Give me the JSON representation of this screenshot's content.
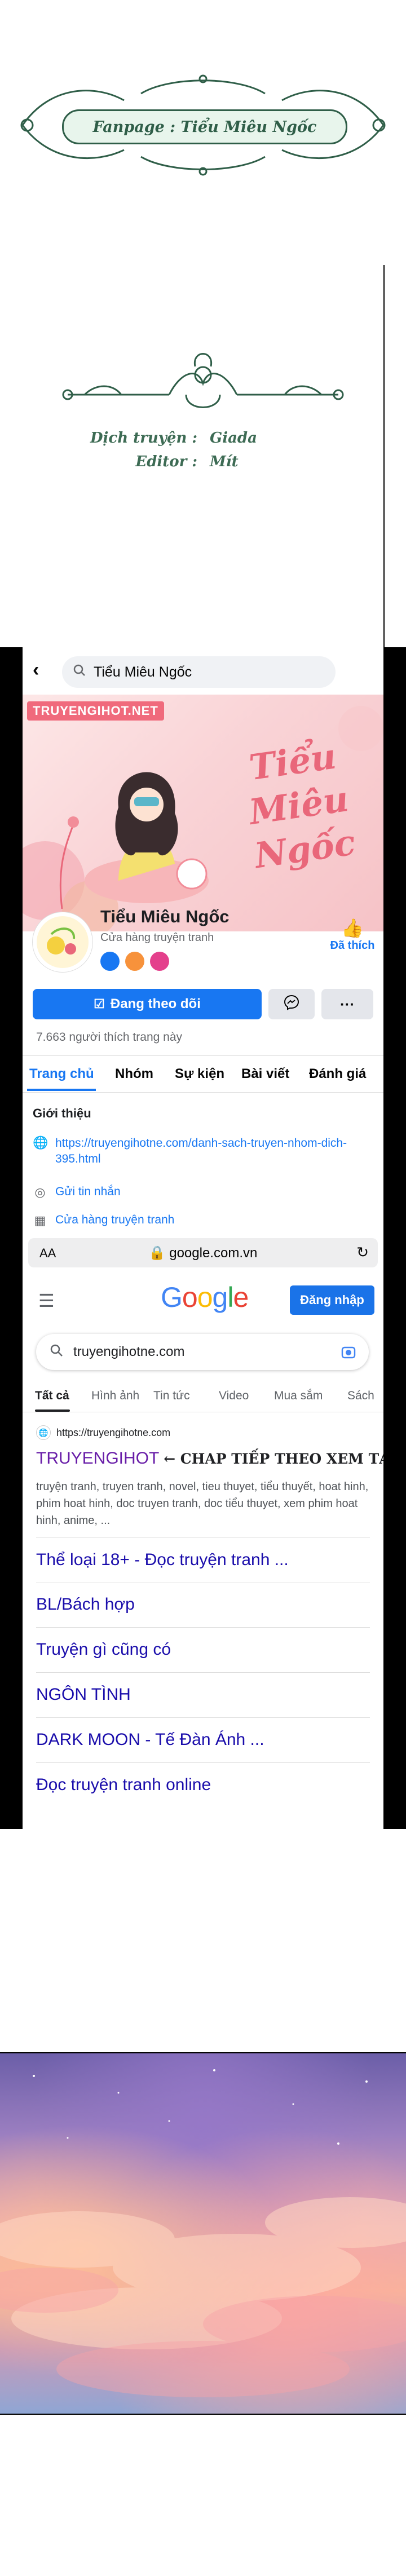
{
  "header": {
    "fanpage_label": "Fanpage : Tiểu Miêu Ngốc",
    "credits": [
      {
        "key": "Dịch truyện :",
        "value": "Giada"
      },
      {
        "key": "Editor :",
        "value": "Mít"
      }
    ]
  },
  "facebook": {
    "search_text": "Tiểu Miêu Ngốc",
    "cover_brand": "TRUYENGIHOT.NET",
    "cover_title": "Tiểu Miêu Ngốc",
    "page_name": "Tiểu Miêu Ngốc",
    "page_category": "Cửa hàng truyện tranh",
    "like_label": "Đã thích",
    "follow_label": "Đang theo dõi",
    "likes_count": "7.663 người thích trang này",
    "tabs": [
      "Trang chủ",
      "Nhóm",
      "Sự kiện",
      "Bài viết",
      "Đánh giá"
    ],
    "active_tab": "Trang chủ",
    "intro_title": "Giới thiệu",
    "intro_link": "https://truyengihotne.com/danh-sach-truyen-nhom-dich-395.html",
    "message_label": "Gửi tin nhắn",
    "category_label": "Cửa hàng truyện tranh"
  },
  "browser": {
    "aa_label": "AA",
    "url": "google.com.vn"
  },
  "google": {
    "logo": "Google",
    "signin_label": "Đăng nhập",
    "query": "truyengihotne.com",
    "tabs": [
      "Tất cả",
      "Hình ảnh",
      "Tin tức",
      "Video",
      "Mua sắm",
      "Sách"
    ],
    "active_tab": "Tất cả",
    "result": {
      "url": "https://truyengihotne.com",
      "title": "TRUYENGIHOT",
      "title_extra": "← CHAP TIẾP THEO XEM TẠI ĐÂY NHA",
      "snippet": "truyện tranh, truyen tranh, novel, tieu thuyet, tiểu thuyết, hoat hinh, phim hoat hinh, doc truyen tranh, doc tiểu thuyet, xem phim hoat hinh, anime, ...",
      "sitelinks": [
        "Thể loại 18+ - Đọc truyện tranh ...",
        "BL/Bách hợp",
        "Truyện gì cũng có",
        "NGÔN TÌNH",
        "DARK MOON - Tế Đàn Ánh ...",
        "Đọc truyện tranh online"
      ]
    }
  },
  "colors": {
    "facebook_blue": "#1877f2",
    "google_link": "#1a0dab",
    "visited_link": "#681da8",
    "ornament_green": "#2f5e48"
  }
}
